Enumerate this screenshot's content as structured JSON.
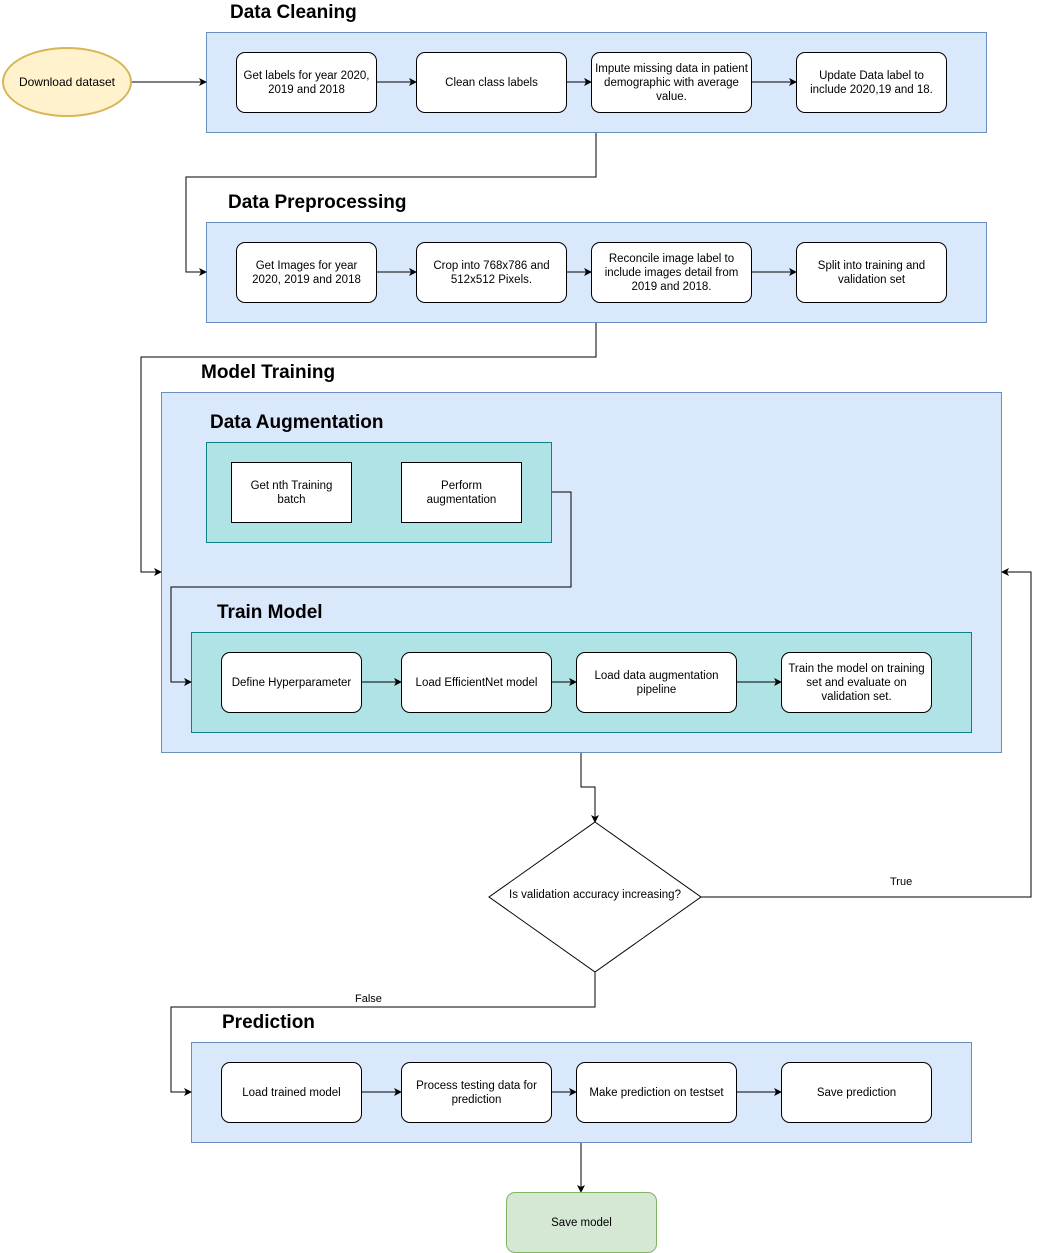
{
  "start": {
    "label": "Download dataset"
  },
  "data_cleaning": {
    "title": "Data Cleaning",
    "steps": [
      "Get labels for year 2020, 2019 and 2018",
      "Clean class labels",
      "Impute missing data in patient demographic with average value.",
      "Update Data label to include 2020,19 and 18."
    ]
  },
  "data_preprocessing": {
    "title": "Data Preprocessing",
    "steps": [
      "Get Images for year 2020, 2019 and 2018",
      "Crop into 768x786 and 512x512 Pixels.",
      "Reconcile image label to include images detail from 2019 and 2018.",
      "Split into training and validation set"
    ]
  },
  "model_training": {
    "title": "Model Training",
    "data_augmentation": {
      "title": "Data Augmentation",
      "steps": [
        "Get nth Training batch",
        "Perform augmentation"
      ]
    },
    "train_model": {
      "title": "Train Model",
      "steps": [
        "Define Hyperparameter",
        "Load EfficientNet model",
        "Load data augmentation pipeline",
        "Train the model on training set and evaluate on validation set."
      ]
    }
  },
  "decision": {
    "label": "Is validation accuracy increasing?",
    "true_label": "True",
    "false_label": "False"
  },
  "prediction": {
    "title": "Prediction",
    "steps": [
      "Load trained model",
      "Process testing data for prediction",
      "Make prediction on testset",
      "Save prediction"
    ]
  },
  "end": {
    "label": "Save model"
  },
  "colors": {
    "container": "#dae8fc",
    "subcontainer": "#b0e3e6",
    "start": "#fff2cc",
    "end": "#d5e8d4"
  }
}
